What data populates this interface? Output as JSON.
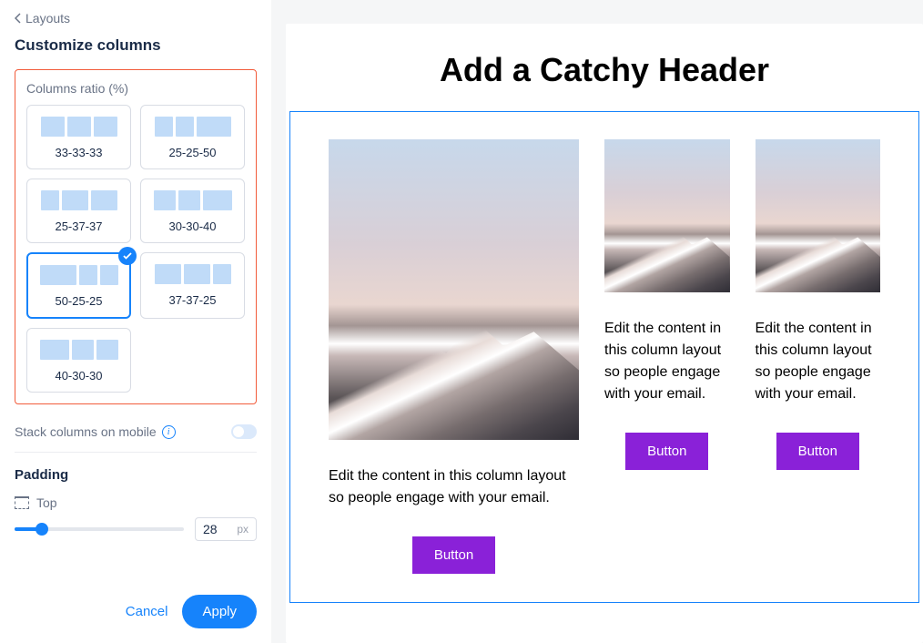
{
  "back_label": "Layouts",
  "title": "Customize columns",
  "ratio_label": "Columns ratio (%)",
  "ratios": [
    {
      "label": "33-33-33",
      "widths": [
        26,
        26,
        26
      ],
      "selected": false
    },
    {
      "label": "25-25-50",
      "widths": [
        20,
        20,
        38
      ],
      "selected": false
    },
    {
      "label": "25-37-37",
      "widths": [
        20,
        29,
        29
      ],
      "selected": false
    },
    {
      "label": "30-30-40",
      "widths": [
        24,
        24,
        32
      ],
      "selected": false
    },
    {
      "label": "50-25-25",
      "widths": [
        40,
        20,
        20
      ],
      "selected": true
    },
    {
      "label": "37-37-25",
      "widths": [
        29,
        29,
        20
      ],
      "selected": false
    },
    {
      "label": "40-30-30",
      "widths": [
        32,
        24,
        24
      ],
      "selected": false
    }
  ],
  "stack_label": "Stack columns on mobile",
  "stack_enabled": false,
  "padding_title": "Padding",
  "padding_side": "Top",
  "padding_value": "28",
  "padding_unit": "px",
  "cancel_label": "Cancel",
  "apply_label": "Apply",
  "preview": {
    "header": "Add a Catchy Header",
    "col1_text": "Edit the content in this column layout so people engage with your email.",
    "col2_text": "Edit the content in this column layout so people engage with your email.",
    "col3_text": "Edit the content in this column layout so people engage with your email.",
    "button_label": "Button"
  }
}
